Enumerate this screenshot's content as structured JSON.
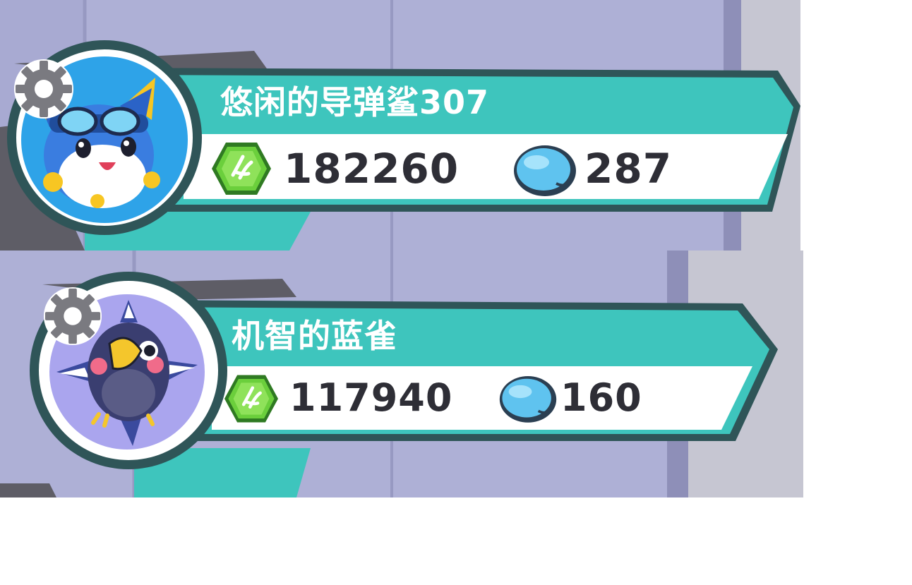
{
  "colors": {
    "banner_teal": "#3ec5bd",
    "banner_border": "#2f5558",
    "background_lavender": "#aeb0d6",
    "stat_text": "#2e2e36",
    "name_text": "#ffffff",
    "gem_green": "#6bcf3c",
    "bean_blue": "#5fc3ef"
  },
  "players": [
    {
      "name": "悠闲的导弹鲨307",
      "gems": "182260",
      "beans": "287",
      "avatar_icon": "blue-fox-goggles-avatar",
      "settings_icon": "gear-icon"
    },
    {
      "name": "机智的蓝雀",
      "gems": "117940",
      "beans": "160",
      "avatar_icon": "blue-bird-avatar",
      "settings_icon": "gear-icon"
    }
  ]
}
